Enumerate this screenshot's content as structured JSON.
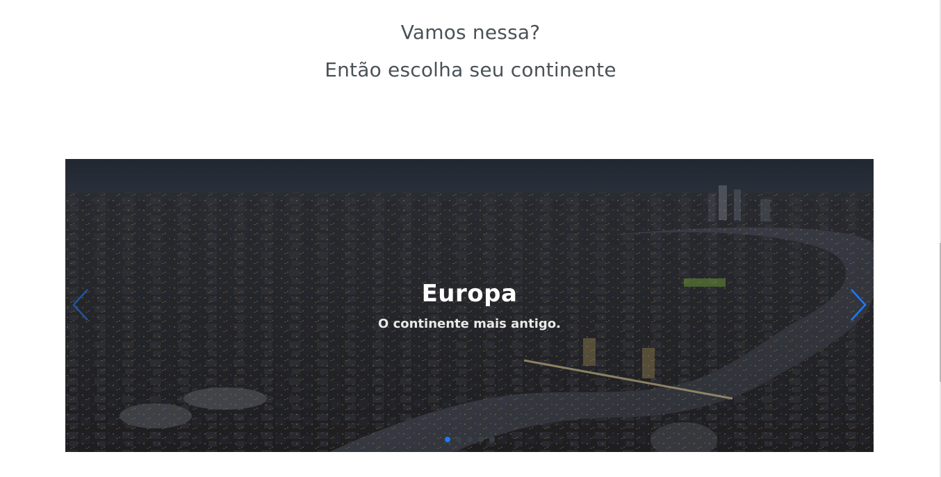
{
  "intro": {
    "line1": "Vamos nessa?",
    "line2": "Então escolha seu continente"
  },
  "carousel": {
    "slide_title": "Europa",
    "slide_subtitle": "O continente mais antigo.",
    "image_alt": "Vista aérea noturna de Londres com o Rio Tâmisa e a Tower Bridge",
    "prev_icon": "chevron-left-icon",
    "next_icon": "chevron-right-icon",
    "slide_count": 5,
    "active_slide": 1
  },
  "colors": {
    "heading": "#4a5257",
    "accent": "#1a7bff",
    "dot_inactive": "#3a4048",
    "overlay": "#000000"
  }
}
